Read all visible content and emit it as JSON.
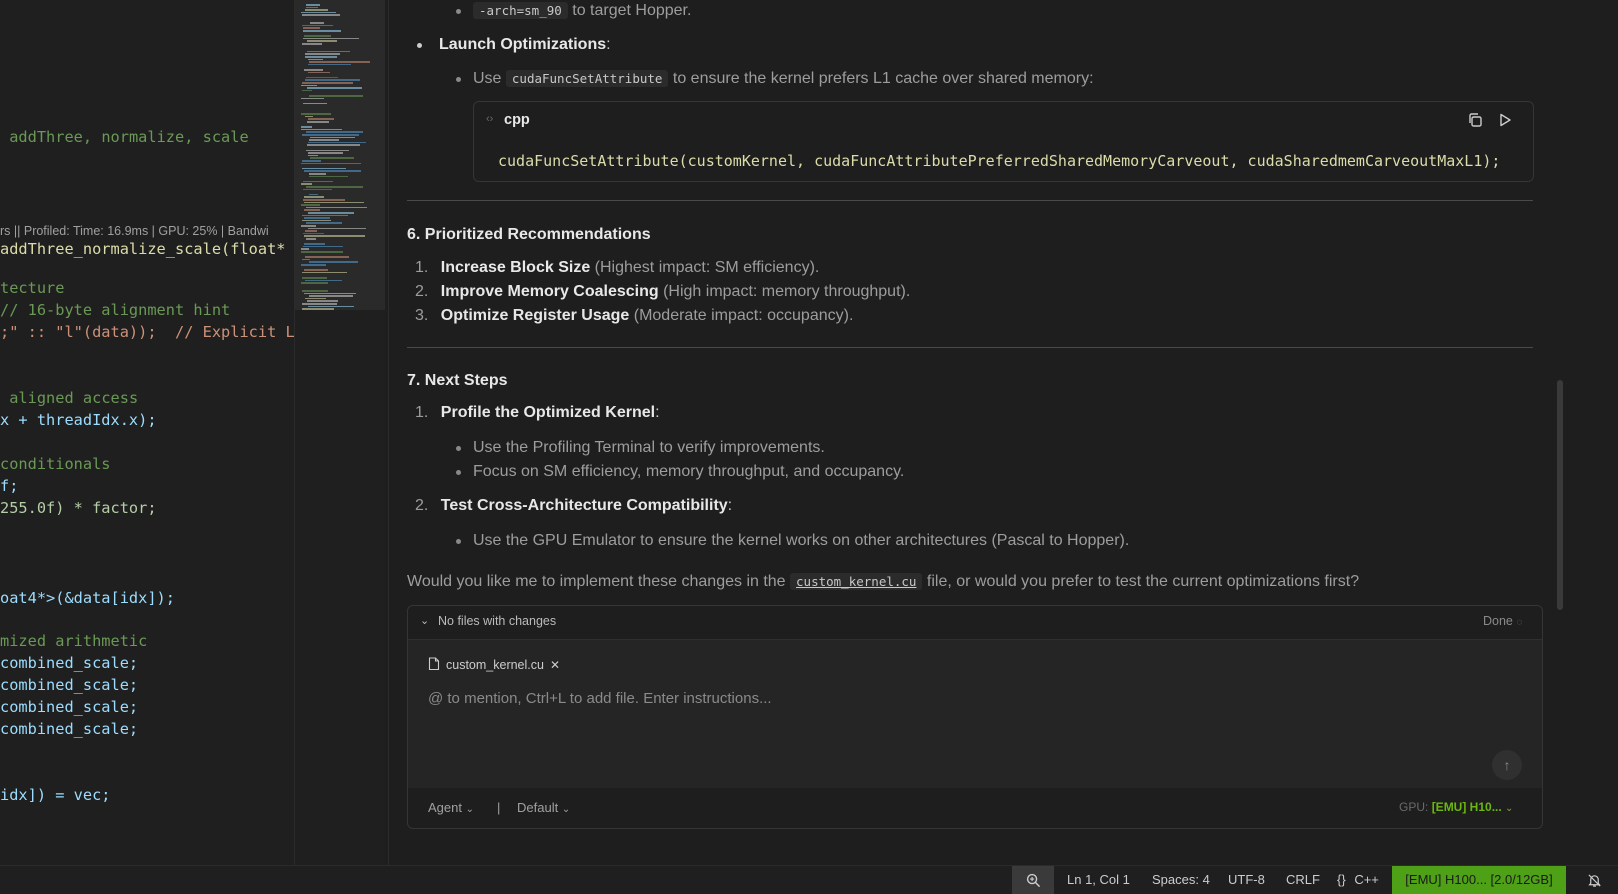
{
  "editor": {
    "codelens": "rs || Profiled: Time: 16.9ms | GPU: 25% | Bandwi",
    "lines": [
      {
        "t": "addThree, normalize, scale",
        "c": "text"
      },
      {
        "t": "addThree_normalize_scale(float* d",
        "c": "fnsig"
      },
      {
        "t": "tecture",
        "c": "comment"
      },
      {
        "t": "// 16-byte alignment hint",
        "c": "comment"
      },
      {
        "t": ";\" :: \"l\"(data));  // Explicit L",
        "c": "asm"
      },
      {
        "t": "aligned access",
        "c": "comment"
      },
      {
        "t": "x + threadIdx.x);",
        "c": "text"
      },
      {
        "t": "conditionals",
        "c": "comment"
      },
      {
        "t": "f;",
        "c": "text"
      },
      {
        "t": "255.0f) * factor;",
        "c": "text"
      },
      {
        "t": "oat4*>(&data[idx]);",
        "c": "text"
      },
      {
        "t": "mized arithmetic",
        "c": "comment"
      },
      {
        "t": "combined_scale;",
        "c": "text"
      },
      {
        "t": "combined_scale;",
        "c": "text"
      },
      {
        "t": "combined_scale;",
        "c": "text"
      },
      {
        "t": "combined_scale;",
        "c": "text"
      },
      {
        "t": "idx]) = vec;",
        "c": "text"
      }
    ]
  },
  "chat": {
    "top_bullet_code": "-arch=sm_90",
    "top_bullet_text": "to target Hopper.",
    "launch_heading": "Launch Optimizations",
    "launch_colon": ":",
    "use_word": "Use",
    "use_code": "cudaFuncSetAttribute",
    "use_rest": "to ensure the kernel prefers L1 cache over shared memory:",
    "codeblock": {
      "lang": "cpp",
      "code": "cudaFuncSetAttribute(customKernel, cudaFuncAttributePreferredSharedMemoryCarveout, cudaSharedmemCarveoutMaxL1);"
    },
    "section6": {
      "title": "6. Prioritized Recommendations",
      "items": [
        {
          "num": "1.",
          "bold": "Increase Block Size",
          "rest": "(Highest impact: SM efficiency)."
        },
        {
          "num": "2.",
          "bold": "Improve Memory Coalescing",
          "rest": "(High impact: memory throughput)."
        },
        {
          "num": "3.",
          "bold": "Optimize Register Usage",
          "rest": "(Moderate impact: occupancy)."
        }
      ]
    },
    "section7": {
      "title": "7. Next Steps",
      "item1": {
        "num": "1.",
        "bold": "Profile the Optimized Kernel",
        "colon": ":"
      },
      "item1_bullets": [
        "Use the Profiling Terminal to verify improvements.",
        "Focus on SM efficiency, memory throughput, and occupancy."
      ],
      "item2": {
        "num": "2.",
        "bold": "Test Cross-Architecture Compatibility",
        "colon": ":"
      },
      "item2_bullets": [
        "Use the GPU Emulator to ensure the kernel works on other architectures (Pascal to Hopper)."
      ]
    },
    "question_pre": "Would you like me to implement these changes in the",
    "question_code": "custom_kernel.cu",
    "question_post": "file, or would you prefer to test the current optimizations first?"
  },
  "composer": {
    "changes_label": "No files with changes",
    "done_label": "Done",
    "file_chip": "custom_kernel.cu",
    "placeholder": "@ to mention, Ctrl+L to add file. Enter instructions...",
    "mode": "Agent",
    "separator": "|",
    "model": "Default",
    "gpu_label": "GPU:",
    "gpu_value": "[EMU] H10..."
  },
  "statusbar": {
    "position": "Ln 1, Col 1",
    "spaces": "Spaces: 4",
    "encoding": "UTF-8",
    "eol": "CRLF",
    "language_icon": "{}",
    "language": "C++",
    "gpu": "[EMU] H100... [2.0/12GB]"
  },
  "colors": {
    "gpu_badge": "#4ea016",
    "comment": "#6a9955",
    "function": "#dcdcaa"
  }
}
